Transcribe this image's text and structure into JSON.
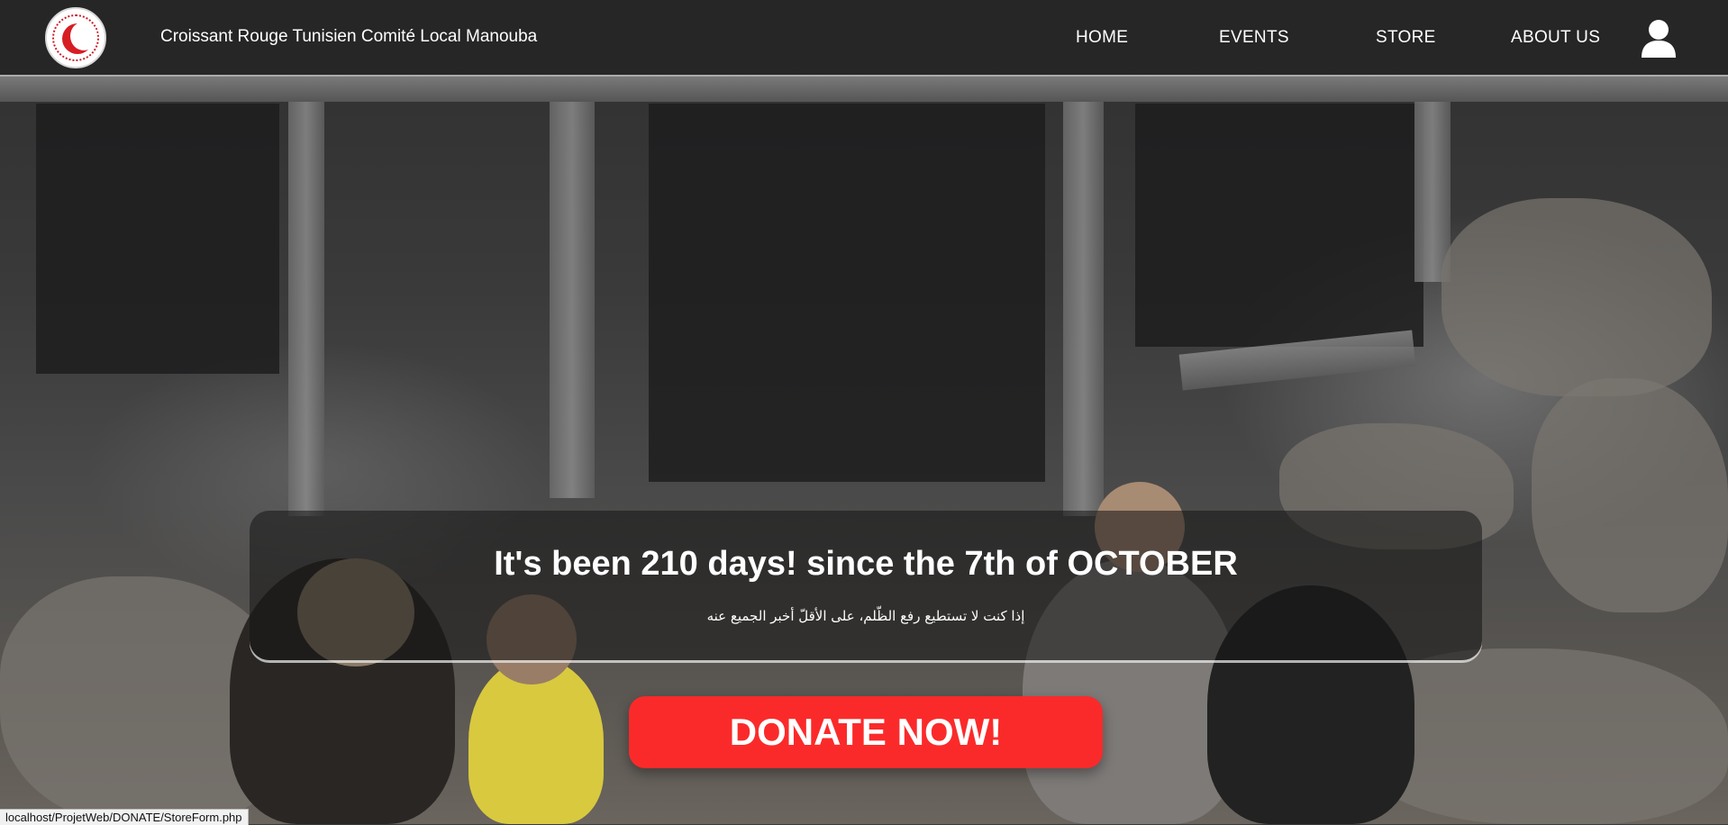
{
  "navbar": {
    "brand": "Croissant Rouge Tunisien Comité Local Manouba",
    "links": [
      {
        "label": "HOME"
      },
      {
        "label": "EVENTS"
      },
      {
        "label": "STORE"
      },
      {
        "label": "ABOUT US"
      }
    ],
    "logo_icon": "red-crescent-logo-icon",
    "user_icon": "user-icon"
  },
  "banner": {
    "title": "It's been 210 days! since the 7th of OCTOBER",
    "subtitle": "إذا كنت لا تستطيع رفع الظّلم، على الأقلّ أخبر الجميع عنه"
  },
  "cta": {
    "donate_label": "DONATE NOW!"
  },
  "status_bar": {
    "url": "localhost/ProjetWeb/DONATE/StoreForm.php"
  },
  "colors": {
    "accent": "#fb2a2a",
    "navbar_bg": "#232323"
  }
}
